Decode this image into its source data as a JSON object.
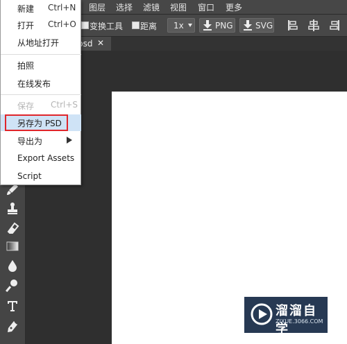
{
  "menubar": {
    "items": [
      "图层",
      "选择",
      "滤镜",
      "视图",
      "窗口",
      "更多"
    ]
  },
  "options": {
    "transform_label": "变换工具",
    "distance_label": "距离",
    "zoom_value": "1x",
    "png_label": "PNG",
    "svg_label": "SVG"
  },
  "tab": {
    "name": "psd",
    "close": "✕"
  },
  "file_menu": {
    "items": [
      {
        "label": "新建",
        "shortcut": "Ctrl+N",
        "enabled": true
      },
      {
        "label": "打开",
        "shortcut": "Ctrl+O",
        "enabled": true
      },
      {
        "label": "从地址打开",
        "shortcut": "",
        "enabled": true
      },
      {
        "label": "拍照",
        "shortcut": "",
        "enabled": true
      },
      {
        "label": "在线发布",
        "shortcut": "",
        "enabled": true
      },
      {
        "label": "保存",
        "shortcut": "Ctrl+S",
        "enabled": false
      },
      {
        "label": "另存为 PSD",
        "shortcut": "",
        "enabled": true,
        "highlighted": true
      },
      {
        "label": "导出为",
        "shortcut": "",
        "enabled": true,
        "submenu": true
      },
      {
        "label": "Export Assets",
        "shortcut": "",
        "enabled": true
      },
      {
        "label": "Script",
        "shortcut": "",
        "enabled": true
      }
    ]
  },
  "toolbar": {
    "tools": [
      "brush-icon",
      "stamp-icon",
      "eraser-icon",
      "gradient-icon",
      "blur-drop-icon",
      "dodge-icon",
      "text-icon",
      "pen-icon"
    ]
  },
  "watermark": {
    "brand": "溜溜自学",
    "url": "ZIXUE.3066.COM"
  },
  "colors": {
    "menu_highlight": "#cfe3f6",
    "callout_red": "#e0252a",
    "canvas": "#ffffff",
    "app_bg": "#2f2f2f"
  }
}
